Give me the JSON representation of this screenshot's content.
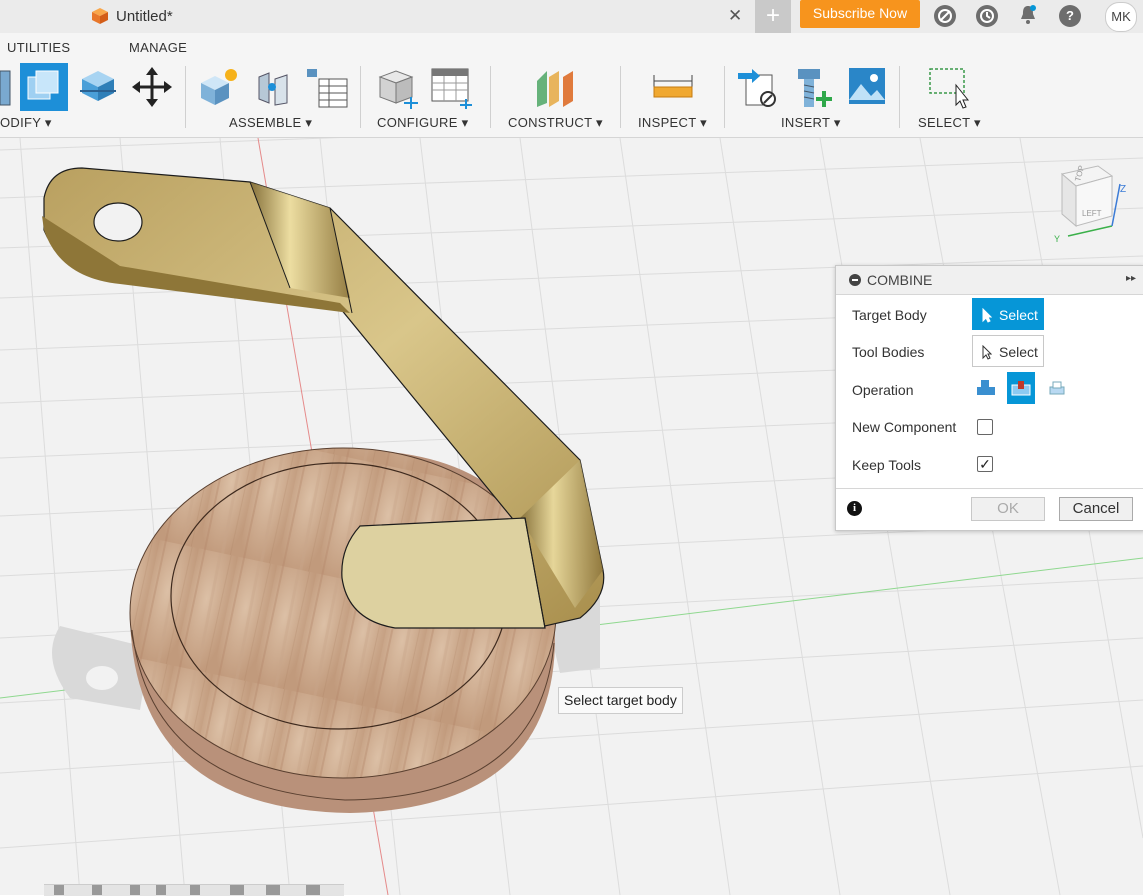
{
  "window": {
    "doc_title": "Untitled*",
    "subscribe_label": "Subscribe Now",
    "user_initials": "MK",
    "new_tab_symbol": "+",
    "close_symbol": "✕"
  },
  "toolbar": {
    "tabs": [
      "UTILITIES",
      "MANAGE"
    ],
    "groups": {
      "modify": "ODIFY ▾",
      "assemble": "ASSEMBLE ▾",
      "configure": "CONFIGURE ▾",
      "construct": "CONSTRUCT ▾",
      "inspect": "INSPECT ▾",
      "insert": "INSERT ▾",
      "select": "SELECT ▾"
    }
  },
  "viewcube": {
    "top": "TOP",
    "left": "LEFT",
    "axis_x": "Y",
    "axis_z": "Z"
  },
  "combine_dialog": {
    "title": "COMBINE",
    "expand_symbol": "▸▸",
    "target_body_label": "Target Body",
    "target_body_button": "Select",
    "tool_bodies_label": "Tool Bodies",
    "tool_bodies_button": "Select",
    "operation_label": "Operation",
    "operation_selected": "cut",
    "new_component_label": "New Component",
    "new_component_checked": false,
    "keep_tools_label": "Keep Tools",
    "keep_tools_checked": true,
    "info_symbol": "i",
    "ok_label": "OK",
    "cancel_label": "Cancel"
  },
  "tooltip": {
    "text": "Select target body"
  },
  "colors": {
    "accent": "#0696d7",
    "subscribe": "#f7941d",
    "wood": "#cfae94",
    "brass": "#c9b46e"
  }
}
